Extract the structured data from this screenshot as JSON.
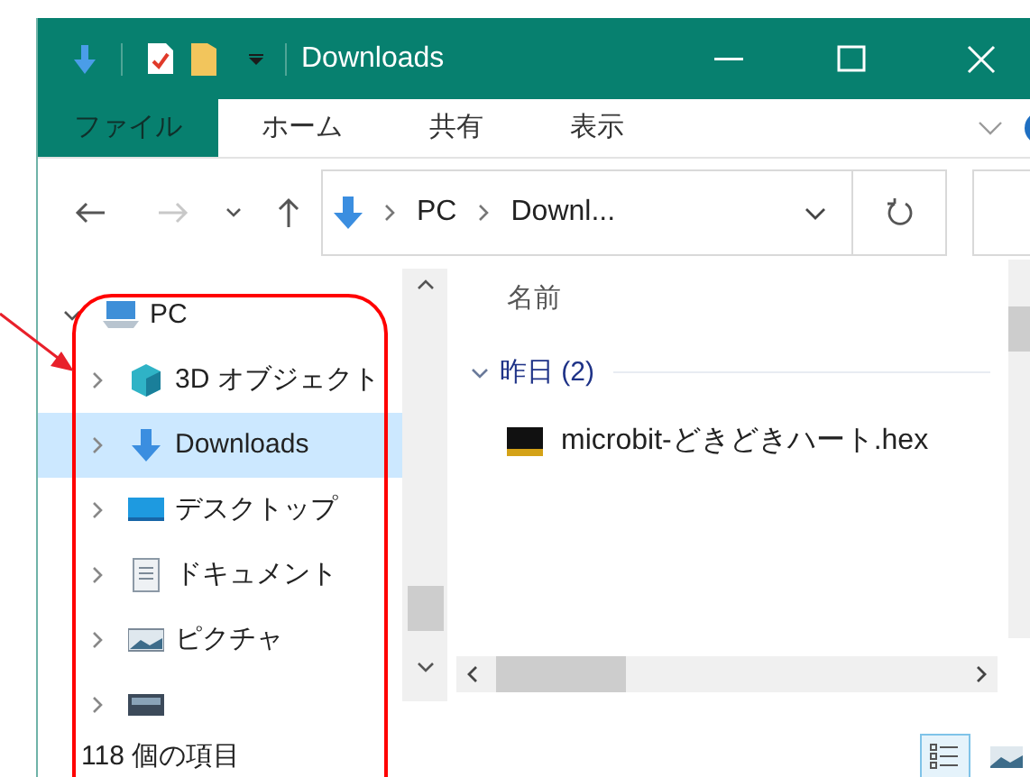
{
  "window": {
    "title": "Downloads"
  },
  "ribbon_tabs": [
    {
      "label": "ファイル",
      "selected": true
    },
    {
      "label": "ホーム",
      "selected": false
    },
    {
      "label": "共有",
      "selected": false
    },
    {
      "label": "表示",
      "selected": false
    }
  ],
  "address": {
    "crumbs": [
      "PC",
      "Downl..."
    ]
  },
  "nav": {
    "items": [
      {
        "label": "PC",
        "kind": "pc",
        "expanded": true,
        "selected": false,
        "children": [
          {
            "label": "3D オブジェクト",
            "kind": "cube",
            "expanded": false,
            "selected": false
          },
          {
            "label": "Downloads",
            "kind": "download",
            "expanded": false,
            "selected": true
          },
          {
            "label": "デスクトップ",
            "kind": "desktop",
            "expanded": false,
            "selected": false
          },
          {
            "label": "ドキュメント",
            "kind": "document",
            "expanded": false,
            "selected": false
          },
          {
            "label": "ピクチャ",
            "kind": "pictures",
            "expanded": false,
            "selected": false
          },
          {
            "kind": "video",
            "expanded": false,
            "selected": false
          }
        ]
      }
    ]
  },
  "content": {
    "column_header": "名前",
    "groups": [
      {
        "label": "昨日 (2)",
        "expanded": true,
        "files": [
          {
            "name": "microbit-どきどきハート.hex"
          }
        ]
      }
    ]
  },
  "status_bar": {
    "item_count": "118 個の項目",
    "views": [
      {
        "kind": "details",
        "selected": true
      },
      {
        "kind": "tiles",
        "selected": false
      }
    ]
  }
}
